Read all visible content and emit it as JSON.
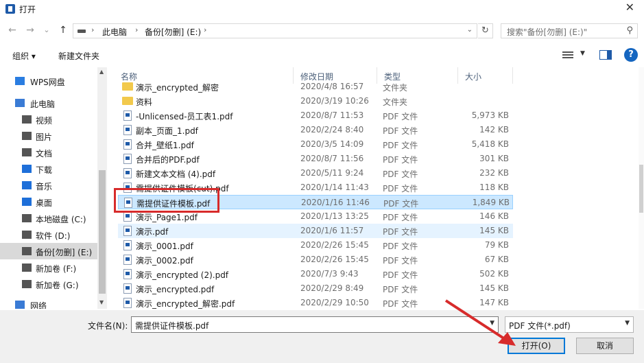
{
  "window": {
    "title": "打开",
    "close_glyph": "✕"
  },
  "nav": {
    "back": "←",
    "forward": "→",
    "recent": "⌄",
    "up": "↑",
    "breadcrumbs": [
      "此电脑",
      "备份[勿删] (E:)"
    ],
    "sep": "›",
    "refresh": "↻",
    "search_placeholder": "搜索\"备份[勿删] (E:)\"",
    "search_icon": "⚲"
  },
  "toolbar": {
    "organize": "组织 ▾",
    "new_folder": "新建文件夹",
    "help": "?"
  },
  "sidebar": {
    "items": [
      {
        "label": "WPS网盘",
        "icon": "cloud-icon",
        "color": "#2a7de1"
      },
      {
        "label": "此电脑",
        "icon": "computer-icon",
        "color": "#3a7bd5"
      },
      {
        "label": "视频",
        "icon": "video-icon",
        "color": "#555555"
      },
      {
        "label": "图片",
        "icon": "picture-icon",
        "color": "#555555"
      },
      {
        "label": "文档",
        "icon": "document-icon",
        "color": "#555555"
      },
      {
        "label": "下载",
        "icon": "download-icon",
        "color": "#1e6fd9"
      },
      {
        "label": "音乐",
        "icon": "music-icon",
        "color": "#1e6fd9"
      },
      {
        "label": "桌面",
        "icon": "desktop-icon",
        "color": "#1e6fd9"
      },
      {
        "label": "本地磁盘 (C:)",
        "icon": "drive-icon",
        "color": "#555555"
      },
      {
        "label": "软件 (D:)",
        "icon": "drive-icon",
        "color": "#555555"
      },
      {
        "label": "备份[勿删] (E:)",
        "icon": "drive-icon",
        "color": "#555555",
        "active": true
      },
      {
        "label": "新加卷 (F:)",
        "icon": "drive-icon",
        "color": "#555555"
      },
      {
        "label": "新加卷 (G:)",
        "icon": "drive-icon",
        "color": "#555555"
      },
      {
        "label": "网络",
        "icon": "network-icon",
        "color": "#3a7bd5"
      }
    ]
  },
  "columns": {
    "name": "名称",
    "date": "修改日期",
    "type": "类型",
    "size": "大小"
  },
  "files": [
    {
      "name": "演示_encrypted_解密",
      "date": "2020/4/8 16:57",
      "type": "文件夹",
      "size": "",
      "kind": "folder"
    },
    {
      "name": "资料",
      "date": "2020/3/19 10:26",
      "type": "文件夹",
      "size": "",
      "kind": "folder"
    },
    {
      "name": "-Unlicensed-员工表1.pdf",
      "date": "2020/8/7 11:53",
      "type": "PDF 文件",
      "size": "5,973 KB",
      "kind": "pdf"
    },
    {
      "name": "副本_页面_1.pdf",
      "date": "2020/2/24 8:40",
      "type": "PDF 文件",
      "size": "142 KB",
      "kind": "pdf"
    },
    {
      "name": "合并_壁纸1.pdf",
      "date": "2020/3/5 14:09",
      "type": "PDF 文件",
      "size": "5,418 KB",
      "kind": "pdf"
    },
    {
      "name": "合并后的PDF.pdf",
      "date": "2020/8/7 11:56",
      "type": "PDF 文件",
      "size": "301 KB",
      "kind": "pdf"
    },
    {
      "name": "新建文本文档 (4).pdf",
      "date": "2020/5/11 9:24",
      "type": "PDF 文件",
      "size": "232 KB",
      "kind": "pdf"
    },
    {
      "name": "需提供证件模板(cut).pdf",
      "date": "2020/1/14 11:43",
      "type": "PDF 文件",
      "size": "118 KB",
      "kind": "pdf"
    },
    {
      "name": "需提供证件模板.pdf",
      "date": "2020/1/16 11:46",
      "type": "PDF 文件",
      "size": "1,849 KB",
      "kind": "pdf",
      "selected": true
    },
    {
      "name": "演示_Page1.pdf",
      "date": "2020/1/13 13:25",
      "type": "PDF 文件",
      "size": "146 KB",
      "kind": "pdf"
    },
    {
      "name": "演示.pdf",
      "date": "2020/1/6 11:57",
      "type": "PDF 文件",
      "size": "145 KB",
      "kind": "pdf",
      "hover": true
    },
    {
      "name": "演示_0001.pdf",
      "date": "2020/2/26 15:45",
      "type": "PDF 文件",
      "size": "79 KB",
      "kind": "pdf"
    },
    {
      "name": "演示_0002.pdf",
      "date": "2020/2/26 15:45",
      "type": "PDF 文件",
      "size": "67 KB",
      "kind": "pdf"
    },
    {
      "name": "演示_encrypted (2).pdf",
      "date": "2020/7/3 9:43",
      "type": "PDF 文件",
      "size": "502 KB",
      "kind": "pdf"
    },
    {
      "name": "演示_encrypted.pdf",
      "date": "2020/2/29 8:49",
      "type": "PDF 文件",
      "size": "145 KB",
      "kind": "pdf"
    },
    {
      "name": "演示_encrypted_解密.pdf",
      "date": "2020/2/29 10:50",
      "type": "PDF 文件",
      "size": "147 KB",
      "kind": "pdf"
    }
  ],
  "footer": {
    "filename_label": "文件名(N):",
    "filename_value": "需提供证件模板.pdf",
    "filter_value": "PDF 文件(*.pdf)",
    "open_label": "打开(O)",
    "cancel_label": "取消",
    "dropdown_glyph": "⌄"
  },
  "colors": {
    "selection_bg": "#cce8ff",
    "highlight_box": "#d72b2b",
    "arrow": "#d72b2b"
  }
}
